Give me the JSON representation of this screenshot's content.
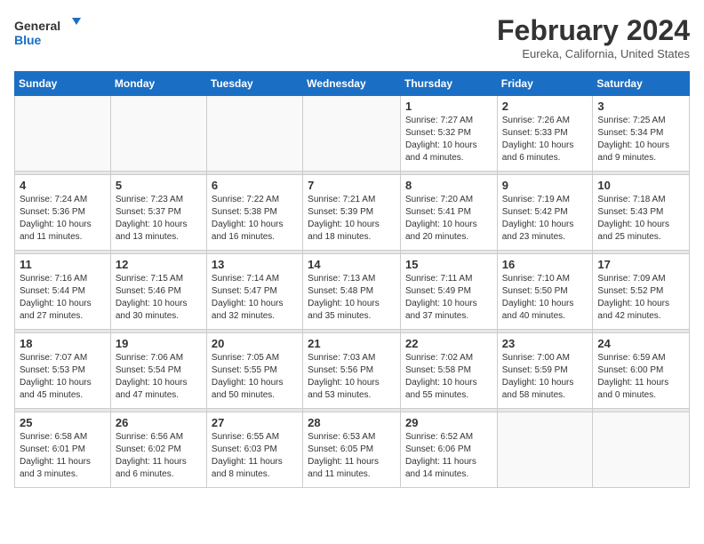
{
  "logo": {
    "text_general": "General",
    "text_blue": "Blue"
  },
  "title": "February 2024",
  "location": "Eureka, California, United States",
  "weekdays": [
    "Sunday",
    "Monday",
    "Tuesday",
    "Wednesday",
    "Thursday",
    "Friday",
    "Saturday"
  ],
  "weeks": [
    [
      {
        "day": "",
        "info": ""
      },
      {
        "day": "",
        "info": ""
      },
      {
        "day": "",
        "info": ""
      },
      {
        "day": "",
        "info": ""
      },
      {
        "day": "1",
        "info": "Sunrise: 7:27 AM\nSunset: 5:32 PM\nDaylight: 10 hours\nand 4 minutes."
      },
      {
        "day": "2",
        "info": "Sunrise: 7:26 AM\nSunset: 5:33 PM\nDaylight: 10 hours\nand 6 minutes."
      },
      {
        "day": "3",
        "info": "Sunrise: 7:25 AM\nSunset: 5:34 PM\nDaylight: 10 hours\nand 9 minutes."
      }
    ],
    [
      {
        "day": "4",
        "info": "Sunrise: 7:24 AM\nSunset: 5:36 PM\nDaylight: 10 hours\nand 11 minutes."
      },
      {
        "day": "5",
        "info": "Sunrise: 7:23 AM\nSunset: 5:37 PM\nDaylight: 10 hours\nand 13 minutes."
      },
      {
        "day": "6",
        "info": "Sunrise: 7:22 AM\nSunset: 5:38 PM\nDaylight: 10 hours\nand 16 minutes."
      },
      {
        "day": "7",
        "info": "Sunrise: 7:21 AM\nSunset: 5:39 PM\nDaylight: 10 hours\nand 18 minutes."
      },
      {
        "day": "8",
        "info": "Sunrise: 7:20 AM\nSunset: 5:41 PM\nDaylight: 10 hours\nand 20 minutes."
      },
      {
        "day": "9",
        "info": "Sunrise: 7:19 AM\nSunset: 5:42 PM\nDaylight: 10 hours\nand 23 minutes."
      },
      {
        "day": "10",
        "info": "Sunrise: 7:18 AM\nSunset: 5:43 PM\nDaylight: 10 hours\nand 25 minutes."
      }
    ],
    [
      {
        "day": "11",
        "info": "Sunrise: 7:16 AM\nSunset: 5:44 PM\nDaylight: 10 hours\nand 27 minutes."
      },
      {
        "day": "12",
        "info": "Sunrise: 7:15 AM\nSunset: 5:46 PM\nDaylight: 10 hours\nand 30 minutes."
      },
      {
        "day": "13",
        "info": "Sunrise: 7:14 AM\nSunset: 5:47 PM\nDaylight: 10 hours\nand 32 minutes."
      },
      {
        "day": "14",
        "info": "Sunrise: 7:13 AM\nSunset: 5:48 PM\nDaylight: 10 hours\nand 35 minutes."
      },
      {
        "day": "15",
        "info": "Sunrise: 7:11 AM\nSunset: 5:49 PM\nDaylight: 10 hours\nand 37 minutes."
      },
      {
        "day": "16",
        "info": "Sunrise: 7:10 AM\nSunset: 5:50 PM\nDaylight: 10 hours\nand 40 minutes."
      },
      {
        "day": "17",
        "info": "Sunrise: 7:09 AM\nSunset: 5:52 PM\nDaylight: 10 hours\nand 42 minutes."
      }
    ],
    [
      {
        "day": "18",
        "info": "Sunrise: 7:07 AM\nSunset: 5:53 PM\nDaylight: 10 hours\nand 45 minutes."
      },
      {
        "day": "19",
        "info": "Sunrise: 7:06 AM\nSunset: 5:54 PM\nDaylight: 10 hours\nand 47 minutes."
      },
      {
        "day": "20",
        "info": "Sunrise: 7:05 AM\nSunset: 5:55 PM\nDaylight: 10 hours\nand 50 minutes."
      },
      {
        "day": "21",
        "info": "Sunrise: 7:03 AM\nSunset: 5:56 PM\nDaylight: 10 hours\nand 53 minutes."
      },
      {
        "day": "22",
        "info": "Sunrise: 7:02 AM\nSunset: 5:58 PM\nDaylight: 10 hours\nand 55 minutes."
      },
      {
        "day": "23",
        "info": "Sunrise: 7:00 AM\nSunset: 5:59 PM\nDaylight: 10 hours\nand 58 minutes."
      },
      {
        "day": "24",
        "info": "Sunrise: 6:59 AM\nSunset: 6:00 PM\nDaylight: 11 hours\nand 0 minutes."
      }
    ],
    [
      {
        "day": "25",
        "info": "Sunrise: 6:58 AM\nSunset: 6:01 PM\nDaylight: 11 hours\nand 3 minutes."
      },
      {
        "day": "26",
        "info": "Sunrise: 6:56 AM\nSunset: 6:02 PM\nDaylight: 11 hours\nand 6 minutes."
      },
      {
        "day": "27",
        "info": "Sunrise: 6:55 AM\nSunset: 6:03 PM\nDaylight: 11 hours\nand 8 minutes."
      },
      {
        "day": "28",
        "info": "Sunrise: 6:53 AM\nSunset: 6:05 PM\nDaylight: 11 hours\nand 11 minutes."
      },
      {
        "day": "29",
        "info": "Sunrise: 6:52 AM\nSunset: 6:06 PM\nDaylight: 11 hours\nand 14 minutes."
      },
      {
        "day": "",
        "info": ""
      },
      {
        "day": "",
        "info": ""
      }
    ]
  ]
}
